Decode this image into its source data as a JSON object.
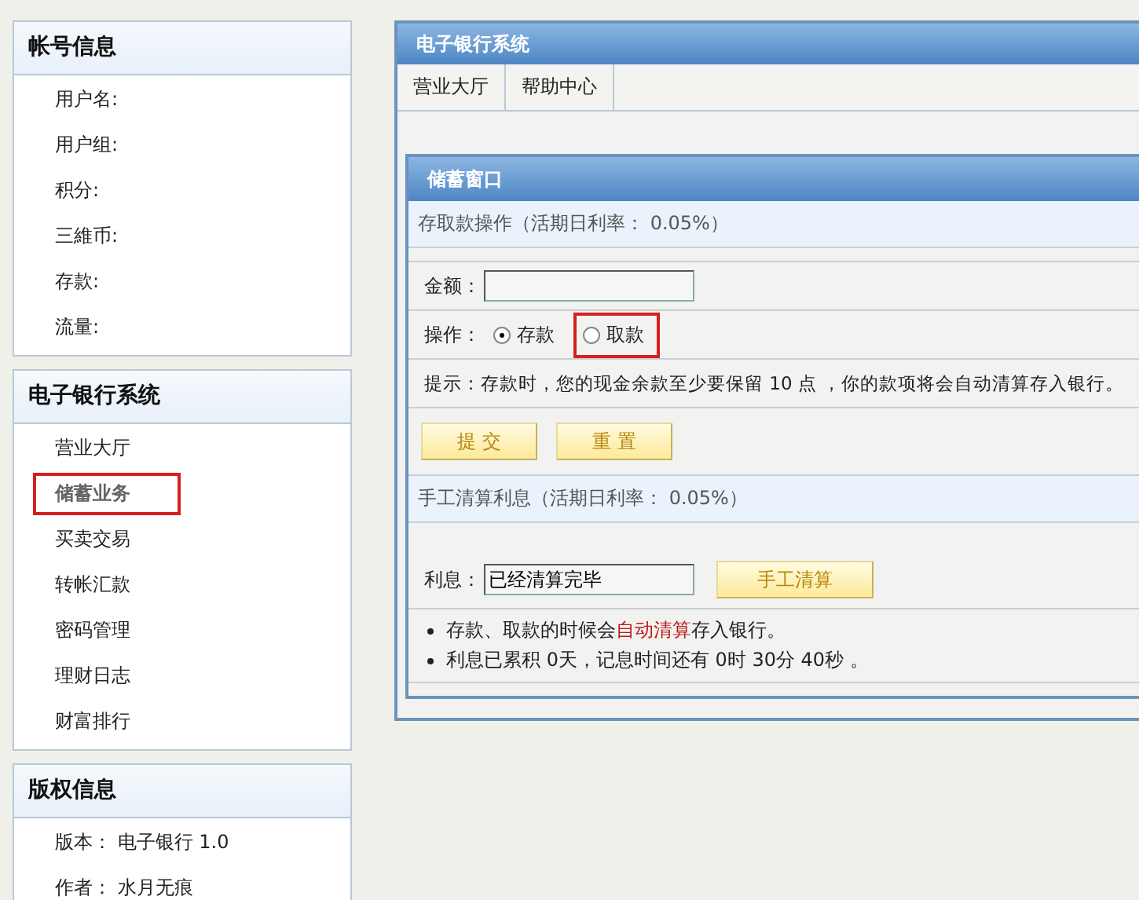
{
  "sidebar": [
    {
      "title": "帐号信息",
      "items": [
        {
          "label": "用户名:"
        },
        {
          "label": "用户组:"
        },
        {
          "label": "积分:"
        },
        {
          "label": "三維币:"
        },
        {
          "label": "存款:"
        },
        {
          "label": "流量:"
        }
      ]
    },
    {
      "title": "电子银行系统",
      "items": [
        {
          "label": "营业大厅",
          "selected": false,
          "highlighted": false
        },
        {
          "label": "储蓄业务",
          "selected": true,
          "highlighted": true
        },
        {
          "label": "买卖交易",
          "selected": false,
          "highlighted": false
        },
        {
          "label": "转帐汇款",
          "selected": false,
          "highlighted": false
        },
        {
          "label": "密码管理",
          "selected": false,
          "highlighted": false
        },
        {
          "label": "理财日志",
          "selected": false,
          "highlighted": false
        },
        {
          "label": "财富排行",
          "selected": false,
          "highlighted": false
        }
      ]
    },
    {
      "title": "版权信息",
      "items": [
        {
          "label": "版本： 电子银行 1.0"
        },
        {
          "label": "作者： 水月无痕"
        }
      ]
    }
  ],
  "main": {
    "title": "电子银行系统",
    "tabs": [
      {
        "label": "营业大厅",
        "selected": false
      },
      {
        "label": "帮助中心",
        "selected": false
      }
    ],
    "window": {
      "title": "储蓄窗口",
      "deposit_section": {
        "heading": "存取款操作（活期日利率： 0.05%）",
        "amount_label": "金额：",
        "operation_label": "操作：",
        "options": [
          {
            "label": "存款",
            "selected": true,
            "highlighted": false
          },
          {
            "label": "取款",
            "selected": false,
            "highlighted": true
          }
        ],
        "hint": "提示：存款时，您的现金余款至少要保留 10 点 ，你的款项将会自动清算存入银行。",
        "buttons": [
          "提 交",
          "重 置"
        ]
      },
      "interest_section": {
        "heading": "手工清算利息（活期日利率： 0.05%）",
        "interest_label": "利息：",
        "interest_value": "已经清算完毕",
        "button": "手工清算",
        "notes": [
          [
            {
              "kind": "plain",
              "text": "存款、取款的时候会"
            },
            {
              "kind": "emphasis",
              "text": "自动清算"
            },
            {
              "kind": "plain",
              "text": "存入银行。"
            }
          ],
          [
            {
              "kind": "plain",
              "text": "利息已累积 0天，记息时间还有 0时 30分 40秒 。"
            }
          ]
        ]
      }
    }
  }
}
